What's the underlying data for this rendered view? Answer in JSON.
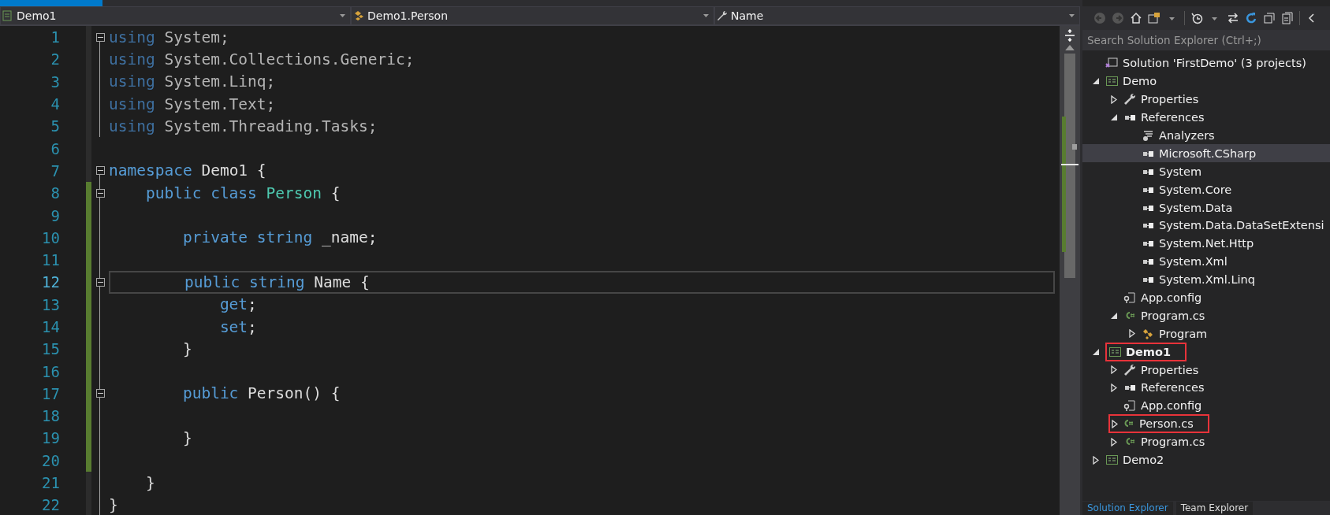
{
  "nav_bar": {
    "project": "Demo1",
    "type": "Demo1.Person",
    "member": "Name"
  },
  "editor": {
    "lines": [
      {
        "number": "1",
        "expanded": true,
        "modified": false,
        "current": false,
        "tokens": [
          {
            "kind": "faded_kw",
            "text": "using"
          },
          {
            "kind": "faded",
            "text": " System;"
          }
        ]
      },
      {
        "number": "2",
        "modified": false,
        "current": false,
        "tokens": [
          {
            "kind": "faded_kw",
            "text": "using"
          },
          {
            "kind": "faded",
            "text": " System.Collections.Generic;"
          }
        ]
      },
      {
        "number": "3",
        "modified": false,
        "current": false,
        "tokens": [
          {
            "kind": "faded_kw",
            "text": "using"
          },
          {
            "kind": "faded",
            "text": " System.Linq;"
          }
        ]
      },
      {
        "number": "4",
        "modified": false,
        "current": false,
        "tokens": [
          {
            "kind": "faded_kw",
            "text": "using"
          },
          {
            "kind": "faded",
            "text": " System.Text;"
          }
        ]
      },
      {
        "number": "5",
        "modified": false,
        "current": false,
        "tokens": [
          {
            "kind": "faded_kw",
            "text": "using"
          },
          {
            "kind": "faded",
            "text": " System.Threading.Tasks;"
          }
        ]
      },
      {
        "number": "6",
        "modified": false,
        "current": false
      },
      {
        "number": "7",
        "expanded": true,
        "modified": false,
        "current": false,
        "tokens": [
          {
            "kind": "keyword",
            "text": "namespace"
          },
          {
            "kind": "plain",
            "text": " Demo1 {"
          }
        ]
      },
      {
        "number": "8",
        "expanded": true,
        "modified": true,
        "current": false,
        "tokens": [
          {
            "kind": "keyword",
            "text": "    public class"
          },
          {
            "kind": "type",
            "text": " Person"
          },
          {
            "kind": "plain",
            "text": " {"
          }
        ]
      },
      {
        "number": "9",
        "modified": true,
        "current": false
      },
      {
        "number": "10",
        "modified": true,
        "current": false,
        "tokens": [
          {
            "kind": "keyword",
            "text": "        private string"
          },
          {
            "kind": "plain",
            "text": " _name;"
          }
        ]
      },
      {
        "number": "11",
        "modified": true,
        "current": false
      },
      {
        "number": "12",
        "expanded": true,
        "modified": true,
        "current": true,
        "tokens": [
          {
            "kind": "keyword",
            "text": "        public string"
          },
          {
            "kind": "plain",
            "text": " Name {"
          }
        ]
      },
      {
        "number": "13",
        "modified": true,
        "current": false,
        "tokens": [
          {
            "kind": "keyword",
            "text": "            get"
          },
          {
            "kind": "plain",
            "text": ";"
          }
        ]
      },
      {
        "number": "14",
        "modified": true,
        "current": false,
        "tokens": [
          {
            "kind": "keyword",
            "text": "            set"
          },
          {
            "kind": "plain",
            "text": ";"
          }
        ]
      },
      {
        "number": "15",
        "modified": true,
        "current": false,
        "tokens": [
          {
            "kind": "plain",
            "text": "        }"
          }
        ]
      },
      {
        "number": "16",
        "modified": true,
        "current": false
      },
      {
        "number": "17",
        "expanded": true,
        "modified": true,
        "current": false,
        "tokens": [
          {
            "kind": "keyword",
            "text": "        public"
          },
          {
            "kind": "plain",
            "text": " Person() {"
          }
        ]
      },
      {
        "number": "18",
        "modified": true,
        "current": false
      },
      {
        "number": "19",
        "modified": true,
        "current": false,
        "tokens": [
          {
            "kind": "plain",
            "text": "        }"
          }
        ]
      },
      {
        "number": "20",
        "modified": true,
        "current": false
      },
      {
        "number": "21",
        "modified": false,
        "current": false,
        "tokens": [
          {
            "kind": "plain",
            "text": "    }"
          }
        ]
      },
      {
        "number": "22",
        "modified": false,
        "current": false,
        "tokens": [
          {
            "kind": "plain",
            "text": "}"
          }
        ]
      }
    ]
  },
  "solution_explorer": {
    "search": {
      "placeholder": "Search Solution Explorer (Ctrl+;)"
    },
    "tree": [
      {
        "label": "Solution 'FirstDemo' (3 projects)",
        "kind": "solution",
        "selected": false,
        "bold": false,
        "highlighted": false
      },
      {
        "label": "Demo",
        "kind": "project",
        "expanded": true,
        "selected": false,
        "bold": false,
        "highlighted": false,
        "children": [
          {
            "label": "Properties",
            "kind": "properties",
            "expanded": false,
            "selected": false,
            "bold": false,
            "highlighted": false
          },
          {
            "label": "References",
            "kind": "reference",
            "expanded": true,
            "selected": false,
            "bold": false,
            "highlighted": false,
            "children": [
              {
                "label": "Analyzers",
                "kind": "analyzer",
                "selected": false,
                "bold": false,
                "highlighted": false
              },
              {
                "label": "Microsoft.CSharp",
                "kind": "reference",
                "selected": true,
                "bold": false,
                "highlighted": false
              },
              {
                "label": "System",
                "kind": "reference",
                "selected": false,
                "bold": false,
                "highlighted": false
              },
              {
                "label": "System.Core",
                "kind": "reference",
                "selected": false,
                "bold": false,
                "highlighted": false
              },
              {
                "label": "System.Data",
                "kind": "reference",
                "selected": false,
                "bold": false,
                "highlighted": false
              },
              {
                "label": "System.Data.DataSetExtensi",
                "kind": "reference",
                "selected": false,
                "bold": false,
                "highlighted": false
              },
              {
                "label": "System.Net.Http",
                "kind": "reference",
                "selected": false,
                "bold": false,
                "highlighted": false
              },
              {
                "label": "System.Xml",
                "kind": "reference",
                "selected": false,
                "bold": false,
                "highlighted": false
              },
              {
                "label": "System.Xml.Linq",
                "kind": "reference",
                "selected": false,
                "bold": false,
                "highlighted": false
              }
            ]
          },
          {
            "label": "App.config",
            "kind": "config",
            "selected": false,
            "bold": false,
            "highlighted": false
          },
          {
            "label": "Program.cs",
            "kind": "csfile",
            "expanded": true,
            "selected": false,
            "bold": false,
            "highlighted": false,
            "children": [
              {
                "label": "Program",
                "kind": "class",
                "expanded": false,
                "selected": false,
                "bold": false,
                "highlighted": false
              }
            ]
          }
        ]
      },
      {
        "label": "Demo1",
        "kind": "project",
        "expanded": true,
        "selected": false,
        "bold": true,
        "highlighted": true,
        "children": [
          {
            "label": "Properties",
            "kind": "properties",
            "expanded": false,
            "selected": false,
            "bold": false,
            "highlighted": false
          },
          {
            "label": "References",
            "kind": "reference",
            "expanded": false,
            "selected": false,
            "bold": false,
            "highlighted": false
          },
          {
            "label": "App.config",
            "kind": "config",
            "selected": false,
            "bold": false,
            "highlighted": false
          },
          {
            "label": "Person.cs",
            "kind": "csfile",
            "expanded": false,
            "selected": false,
            "bold": false,
            "highlighted": true
          },
          {
            "label": "Program.cs",
            "kind": "csfile",
            "expanded": false,
            "selected": false,
            "bold": false,
            "highlighted": false
          }
        ]
      },
      {
        "label": "Demo2",
        "kind": "project",
        "expanded": false,
        "selected": false,
        "bold": false,
        "highlighted": false
      }
    ],
    "bottom_tabs": [
      {
        "label": "Solution Explorer",
        "selected": true
      },
      {
        "label": "Team Explorer",
        "selected": false
      }
    ]
  }
}
